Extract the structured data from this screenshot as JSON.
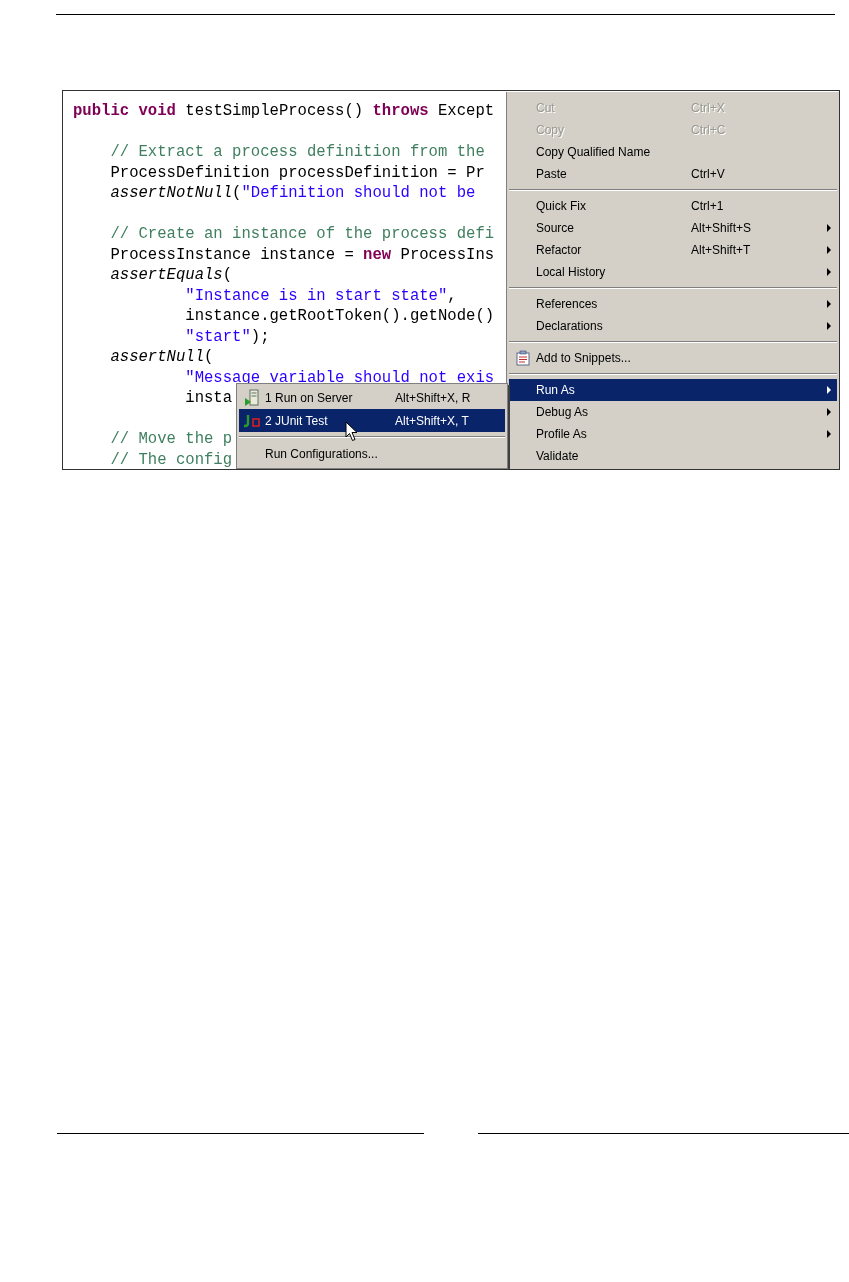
{
  "editor": {
    "lines": [
      {
        "kind": "code",
        "tokens": [
          {
            "kind": "keyword",
            "text": "public"
          },
          {
            "kind": "keyword",
            "text": " void"
          },
          {
            "kind": "plain",
            "text": " testSimpleProcess() "
          },
          {
            "kind": "keyword",
            "text": "throws"
          },
          {
            "kind": "plain",
            "text": " Except"
          }
        ]
      },
      {
        "kind": "blank"
      },
      {
        "kind": "code",
        "tokens": [
          {
            "kind": "comment",
            "text": "    // Extract a process definition from the"
          }
        ]
      },
      {
        "kind": "code",
        "tokens": [
          {
            "kind": "plain",
            "text": "    ProcessDefinition processDefinition = Pr"
          }
        ]
      },
      {
        "kind": "code",
        "tokens": [
          {
            "kind": "italic",
            "text": "    assertNotNull"
          },
          {
            "kind": "plain",
            "text": "("
          },
          {
            "kind": "string",
            "text": "\"Definition should not be"
          }
        ]
      },
      {
        "kind": "blank"
      },
      {
        "kind": "code",
        "tokens": [
          {
            "kind": "comment",
            "text": "    // Create an instance of the process defi"
          }
        ]
      },
      {
        "kind": "code",
        "tokens": [
          {
            "kind": "plain",
            "text": "    ProcessInstance instance = "
          },
          {
            "kind": "keyword",
            "text": "new"
          },
          {
            "kind": "plain",
            "text": " ProcessIns"
          }
        ]
      },
      {
        "kind": "code",
        "tokens": [
          {
            "kind": "italic",
            "text": "    assertEquals"
          },
          {
            "kind": "plain",
            "text": "("
          }
        ]
      },
      {
        "kind": "code",
        "tokens": [
          {
            "kind": "string",
            "text": "            \"Instance is in start state\""
          },
          {
            "kind": "plain",
            "text": ","
          }
        ]
      },
      {
        "kind": "code",
        "tokens": [
          {
            "kind": "plain",
            "text": "            instance.getRootToken().getNode()"
          }
        ]
      },
      {
        "kind": "code",
        "tokens": [
          {
            "kind": "string",
            "text": "            \"start\""
          },
          {
            "kind": "plain",
            "text": ");"
          }
        ]
      },
      {
        "kind": "code",
        "tokens": [
          {
            "kind": "italic",
            "text": "    assertNull"
          },
          {
            "kind": "plain",
            "text": "("
          }
        ]
      },
      {
        "kind": "code",
        "tokens": [
          {
            "kind": "string",
            "text": "            \"Message variable should not exis"
          }
        ]
      },
      {
        "kind": "code",
        "tokens": [
          {
            "kind": "plain",
            "text": "            insta"
          }
        ]
      },
      {
        "kind": "blank"
      },
      {
        "kind": "code",
        "tokens": [
          {
            "kind": "comment",
            "text": "    // Move the p"
          }
        ]
      },
      {
        "kind": "code",
        "tokens": [
          {
            "kind": "comment",
            "text": "    // The config"
          }
        ]
      }
    ]
  },
  "context_menu": {
    "items": [
      {
        "kind": "item",
        "label": "Cut",
        "shortcut": "Ctrl+X",
        "disabled": true,
        "selected": false,
        "submenu": false
      },
      {
        "kind": "item",
        "label": "Copy",
        "shortcut": "Ctrl+C",
        "disabled": true,
        "selected": false,
        "submenu": false
      },
      {
        "kind": "item",
        "label": "Copy Qualified Name",
        "disabled": false,
        "selected": false,
        "submenu": false
      },
      {
        "kind": "item",
        "label": "Paste",
        "shortcut": "Ctrl+V",
        "disabled": false,
        "selected": false,
        "submenu": false
      },
      {
        "kind": "separator"
      },
      {
        "kind": "item",
        "label": "Quick Fix",
        "shortcut": "Ctrl+1",
        "disabled": false,
        "selected": false,
        "submenu": false
      },
      {
        "kind": "item",
        "label": "Source",
        "shortcut": "Alt+Shift+S",
        "disabled": false,
        "selected": false,
        "submenu": true
      },
      {
        "kind": "item",
        "label": "Refactor",
        "shortcut": "Alt+Shift+T",
        "disabled": false,
        "selected": false,
        "submenu": true
      },
      {
        "kind": "item",
        "label": "Local History",
        "disabled": false,
        "selected": false,
        "submenu": true
      },
      {
        "kind": "separator"
      },
      {
        "kind": "item",
        "label": "References",
        "disabled": false,
        "selected": false,
        "submenu": true
      },
      {
        "kind": "item",
        "label": "Declarations",
        "disabled": false,
        "selected": false,
        "submenu": true
      },
      {
        "kind": "separator"
      },
      {
        "kind": "item",
        "label": "Add to Snippets...",
        "disabled": false,
        "selected": false,
        "submenu": false
      },
      {
        "kind": "separator"
      },
      {
        "kind": "item",
        "label": "Run As",
        "disabled": false,
        "selected": true,
        "submenu": true
      },
      {
        "kind": "item",
        "label": "Debug As",
        "disabled": false,
        "selected": false,
        "submenu": true
      },
      {
        "kind": "item",
        "label": "Profile As",
        "disabled": false,
        "selected": false,
        "submenu": true
      },
      {
        "kind": "item",
        "label": "Validate",
        "disabled": false,
        "selected": false,
        "submenu": false
      }
    ]
  },
  "submenu": {
    "items": [
      {
        "kind": "item",
        "label": "1 Run on Server",
        "shortcut": "Alt+Shift+X, R",
        "selected": false
      },
      {
        "kind": "item",
        "label": "2 JUnit Test",
        "shortcut": "Alt+Shift+X, T",
        "selected": true
      },
      {
        "kind": "separator"
      },
      {
        "kind": "item",
        "label": "Run Configurations...",
        "selected": false
      }
    ]
  }
}
